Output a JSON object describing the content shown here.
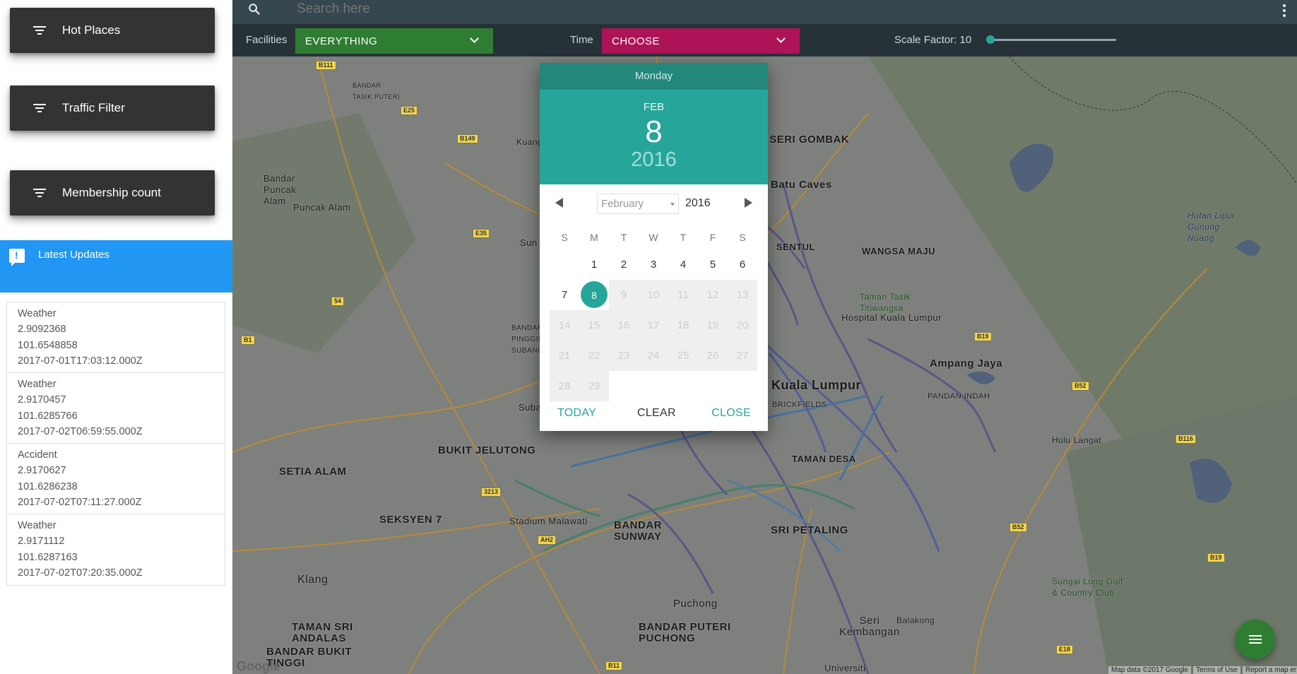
{
  "sidebar": {
    "menu": [
      {
        "label": "Hot Places",
        "icon": "filter-icon"
      },
      {
        "label": "Traffic Filter",
        "icon": "filter-icon"
      },
      {
        "label": "Membership count",
        "icon": "filter-icon"
      }
    ],
    "updates_title": "Latest Updates",
    "updates": [
      {
        "type": "Weather",
        "lat": "2.9092368",
        "lng": "101.6548858",
        "time": "2017-07-01T17:03:12.000Z"
      },
      {
        "type": "Weather",
        "lat": "2.9170457",
        "lng": "101.6285766",
        "time": "2017-07-02T06:59:55.000Z"
      },
      {
        "type": "Accident",
        "lat": "2.9170627",
        "lng": "101.6286238",
        "time": "2017-07-02T07:11:27.000Z"
      },
      {
        "type": "Weather",
        "lat": "2.9171112",
        "lng": "101.6287163",
        "time": "2017-07-02T07:20:35.000Z"
      }
    ]
  },
  "search": {
    "placeholder": "Search here"
  },
  "filters": {
    "facilities_label": "Facilities",
    "facilities_value": "EVERYTHING",
    "time_label": "Time",
    "time_value": "CHOOSE",
    "scale_label": "Scale Factor: 10",
    "scale_value": 10
  },
  "colors": {
    "facilities_dd": "#2e7d32",
    "time_dd": "#ad1457",
    "accent": "#26a69a",
    "updates_header": "#2196f3"
  },
  "datepicker": {
    "weekday": "Monday",
    "month_short": "FEB",
    "day": "8",
    "year": "2016",
    "month_select": "February",
    "year_select": "2016",
    "weekdays": [
      "S",
      "M",
      "T",
      "W",
      "T",
      "F",
      "S"
    ],
    "days": [
      [
        "",
        "1",
        "2",
        "3",
        "4",
        "5",
        "6"
      ],
      [
        "7",
        "8",
        "9",
        "10",
        "11",
        "12",
        "13"
      ],
      [
        "14",
        "15",
        "16",
        "17",
        "18",
        "19",
        "20"
      ],
      [
        "21",
        "22",
        "23",
        "24",
        "25",
        "26",
        "27"
      ],
      [
        "28",
        "29",
        "",
        "",
        "",
        "",
        ""
      ]
    ],
    "selected_day": "8",
    "today_label": "TODAY",
    "clear_label": "CLEAR",
    "close_label": "CLOSE"
  },
  "map": {
    "labels": [
      "TAMAN SERI GOMBAK",
      "Batu Caves",
      "SENTUL",
      "WANGSA MAJU",
      "Taman Tasik Titiwangsa",
      "Hospital Kuala Lumpur",
      "Ampang Jaya",
      "Kuala Lumpur",
      "BRICKFIELDS",
      "PANDAN INDAH",
      "BUKIT JELUTONG",
      "SETIA ALAM",
      "SEKSYEN 7",
      "Stadium Malawati",
      "BANDAR SUNWAY",
      "SRI PETALING",
      "Klang",
      "Puchong",
      "BANDAR PUTERI PUCHONG",
      "Seri Kembangan",
      "TAMAN SRI ANDALAS",
      "BANDAR BUKIT TINGGI",
      "Balakong",
      "Hulu Langat",
      "Sungai Long Golf & Country Club",
      "Bandar Puncak Alam",
      "Puncak Alam",
      "BANDAR TASIK PUTERI",
      "Hutan Lipur Gunung Nuang",
      "TAMAN DESA",
      "Sun",
      "Subang",
      "BANDAR PINGGIR SUBANG",
      "Kuang",
      "Universiti"
    ],
    "footer_data": "Map data ©2017 Google",
    "footer_terms": "Terms of Use",
    "footer_report": "Report a map error",
    "logo": "Google"
  }
}
